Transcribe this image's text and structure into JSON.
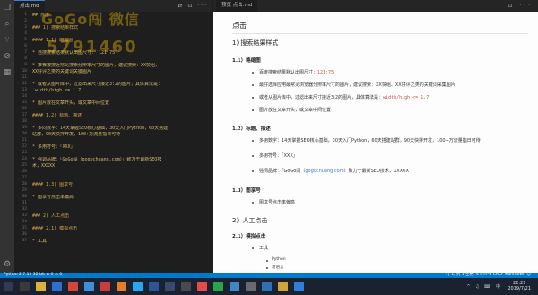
{
  "editor": {
    "tab_title": "点击.md",
    "line_numbers": [
      "1",
      "2",
      "3",
      "4",
      "5",
      "6",
      "7",
      "8",
      "9",
      "10",
      "11",
      "12",
      "13",
      "14",
      "15",
      "16",
      "17",
      "18",
      "19",
      "20",
      "21",
      "22",
      "23",
      "24",
      "25",
      "26",
      "27",
      "28",
      "29",
      "30",
      "31",
      "32",
      "33",
      "34",
      "35",
      "36",
      "37",
      "38",
      "39",
      "40"
    ],
    "lines": [
      "## 点击",
      "",
      "### 1) 搜索结果样式",
      "",
      "#### 1.1) 略缩图",
      "",
      "* 自搜搜索结果默认出图尺寸：`121:75`",
      "",
      "* 推荐按搜近常见搜索分辨率尺寸的图片，建议搜索：XX赞组，",
      "XX好评之类的关键词关键图片",
      "",
      "* 或者从图片库中，过滤出来尺寸接近3:2的图片，具体算法是：",
      "`width/high <= 1.7`",
      "",
      "* 图片放在文章开头，或文章中间位置",
      "",
      "#### 1.2) 标题、描述",
      "",
      "* 多同数字：14天掌握SEO核心基础，30天入门Python，60天搭建",
      "站群，90天快拌开发，100+万流量指日可待",
      "",
      "* 多用符号：「XXX」",
      "",
      "* 强调品牌：「GoGo闯（gogochuang.com）」致力于最新SEO技",
      "术，XXXXX",
      "",
      "",
      "#### 1.3) 图享号",
      "",
      "* 图享号点击率偏高",
      "",
      "",
      "### 2) 人工点击",
      "",
      "#### 2.1) 模拟点击",
      "",
      "* 工具"
    ]
  },
  "watermark": {
    "line1": "GoGo闯 微信",
    "line2": "5791460"
  },
  "preview": {
    "tab_title": "预览 点击.md",
    "h1": "点击",
    "s1": "1) 搜索结果样式",
    "s11": "1.1）略缩图",
    "s11_items": [
      {
        "pre": "百度搜索结果默认出图尺寸：",
        "code": "121:75",
        "post": ""
      },
      {
        "pre": "最好选择应用最常见浏览器分辨率尺寸的图片，建议搜索：XX赞组、XX好评之类的关键词采集图片",
        "code": "",
        "post": ""
      },
      {
        "pre": "或者从图片库中，过滤出来尺寸接近3:2的图片，具体算法是：",
        "code": "width/high <= 1.7",
        "post": ""
      },
      {
        "pre": "图片放在文章开头，或文章中间位置",
        "code": "",
        "post": ""
      }
    ],
    "s12": "1.2）标题、描述",
    "s12_items": [
      {
        "pre": "多用数字：14天掌握SEO核心基础，30天入门Python，60天搭建站群，90天快拌开发，100+万流量指日可待",
        "link": "",
        "post": ""
      },
      {
        "pre": "多用符号：「XXX」",
        "link": "",
        "post": ""
      },
      {
        "pre": "强调品牌：「GoGo闯（",
        "link": "gogochuang.com",
        "post": "）致力于最新SEO技术，XXXXX"
      }
    ],
    "s13": "1.3）图享号",
    "s13_items": [
      "图享号点击率偏高"
    ],
    "s2": "2）人工点击",
    "s21": "2.1）模拟点击",
    "s21_items": [
      "工具"
    ],
    "s21_sub": [
      "Python",
      "易语言"
    ]
  },
  "status": {
    "left": "Python 2.7.12 32-bit   ⊗ 0 ⚠ 0",
    "right": "行 1, 列 1   空格: 4   UTF-8   CRLF   Markdown   ☺"
  },
  "taskbar": {
    "time": "22:29",
    "date": "2019/7/21",
    "tray": "^ ♫ ⌨ 中"
  }
}
